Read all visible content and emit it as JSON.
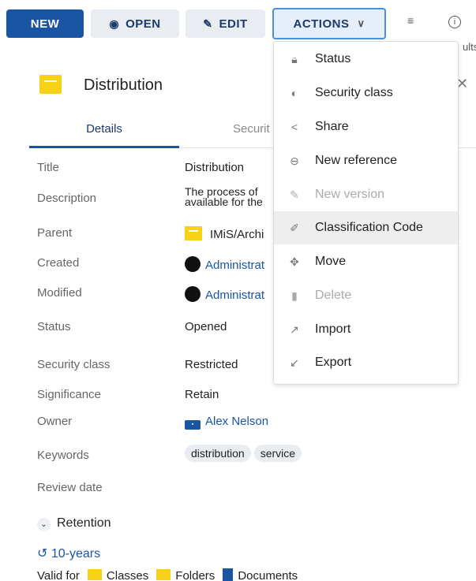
{
  "toolbar": {
    "new_label": "NEW",
    "open_label": "OPEN",
    "edit_label": "EDIT",
    "actions_label": "ACTIONS"
  },
  "partial_text": "ults",
  "header": {
    "title": "Distribution"
  },
  "tabs": {
    "details": "Details",
    "security": "Securit"
  },
  "fields": {
    "title": {
      "label": "Title",
      "value": "Distribution"
    },
    "description": {
      "label": "Description",
      "line1": "The process of",
      "line2": "available for the"
    },
    "parent": {
      "label": "Parent",
      "value": "IMiS/Archi"
    },
    "created": {
      "label": "Created",
      "value": "Administrat"
    },
    "modified": {
      "label": "Modified",
      "value": "Administrat"
    },
    "status": {
      "label": "Status",
      "value": "Opened"
    },
    "security_class": {
      "label": "Security class",
      "value": "Restricted"
    },
    "significance": {
      "label": "Significance",
      "value": "Retain"
    },
    "owner": {
      "label": "Owner",
      "value": "Alex Nelson"
    },
    "keywords": {
      "label": "Keywords",
      "items": [
        "distribution",
        "service"
      ]
    },
    "review_date": {
      "label": "Review date"
    }
  },
  "retention": {
    "label": "Retention",
    "period": "10-years",
    "valid_for_label": "Valid for",
    "classes": "Classes",
    "folders": "Folders",
    "documents": "Documents"
  },
  "actions_menu": [
    {
      "label": "Status",
      "icon": "lock-icon",
      "disabled": false
    },
    {
      "label": "Security class",
      "icon": "shield-icon",
      "disabled": false
    },
    {
      "label": "Share",
      "icon": "share-icon",
      "disabled": false
    },
    {
      "label": "New reference",
      "icon": "link-icon",
      "disabled": false
    },
    {
      "label": "New version",
      "icon": "pencil-icon",
      "disabled": true
    },
    {
      "label": "Classification Code",
      "icon": "edit-icon",
      "disabled": false,
      "hover": true
    },
    {
      "label": "Move",
      "icon": "move-icon",
      "disabled": false
    },
    {
      "label": "Delete",
      "icon": "trash-icon",
      "disabled": true
    },
    {
      "label": "Import",
      "icon": "import-arrow-icon",
      "disabled": false
    },
    {
      "label": "Export",
      "icon": "export-arrow-icon",
      "disabled": false
    }
  ],
  "colors": {
    "primary": "#1a55a4",
    "folder": "#f7d117",
    "focus": "#4a90e2"
  }
}
